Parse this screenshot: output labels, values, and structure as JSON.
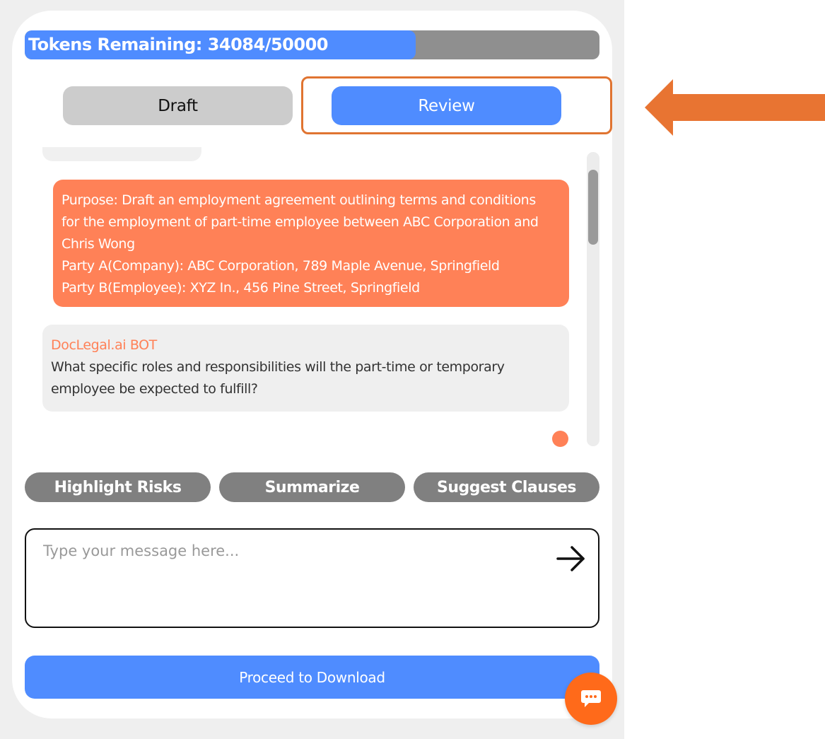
{
  "tokens": {
    "label": "Tokens Remaining: 34084/50000",
    "remaining": 34084,
    "total": 50000,
    "fill_fraction": 0.68
  },
  "modes": {
    "draft_label": "Draft",
    "review_label": "Review",
    "active": "Review"
  },
  "chat": {
    "user_message": {
      "lines": [
        "Purpose: Draft an employment agreement outlining terms and conditions",
        "for the employment of part-time employee between ABC Corporation and",
        "Chris Wong",
        "Party A(Company): ABC Corporation, 789 Maple Avenue, Springfield",
        "Party B(Employee): XYZ In., 456 Pine Street, Springfield"
      ]
    },
    "bot_message": {
      "sender": "DocLegal.ai BOT",
      "lines": [
        "What specific roles and responsibilities will the part-time or temporary",
        "employee be expected to fulfill?"
      ]
    }
  },
  "actions": {
    "highlight_risks": "Highlight Risks",
    "summarize": "Summarize",
    "suggest_clauses": "Suggest Clauses"
  },
  "input": {
    "placeholder": "Type your message here...",
    "value": ""
  },
  "download_label": "Proceed to Download",
  "icons": {
    "send": "arrow-right-icon",
    "chat_fab": "chat-bubble-icon",
    "callout": "left-arrow-callout"
  },
  "colors": {
    "accent_blue": "#4f8cff",
    "user_bubble": "#ff8157",
    "callout_orange": "#e87432",
    "fab_orange": "#ff6a1a",
    "action_gray": "#808080"
  }
}
